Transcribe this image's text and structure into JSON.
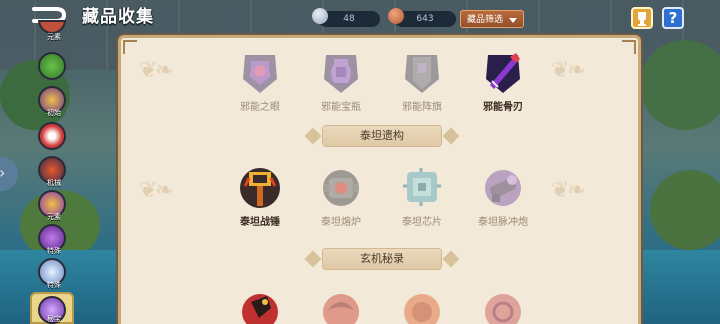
{
  "header": {
    "title": "藏品收集",
    "crystal_count": "48",
    "meat_count": "643",
    "filter_label": "藏品筛选"
  },
  "sidebar": {
    "items": [
      {
        "label": "元素",
        "icon": "creature-red-icon"
      },
      {
        "label": "",
        "icon": "creature-green-icon"
      },
      {
        "label": "初始",
        "icon": "creature-hat-icon"
      },
      {
        "label": "",
        "icon": "creature-mushroom-icon"
      },
      {
        "label": "机械",
        "icon": "creature-mech-icon"
      },
      {
        "label": "元素",
        "icon": "creature-purple-icon"
      },
      {
        "label": "特殊",
        "icon": "creature-spiky-icon"
      },
      {
        "label": "特殊",
        "icon": "creature-ghost-icon"
      },
      {
        "label": "秘宝",
        "icon": "creature-orb-icon"
      }
    ]
  },
  "panel": {
    "row1": [
      {
        "label": "邪能之眼",
        "owned": false,
        "icon": "evil-eye-icon"
      },
      {
        "label": "邪能宝瓶",
        "owned": false,
        "icon": "evil-vase-icon"
      },
      {
        "label": "邪能阵旗",
        "owned": false,
        "icon": "evil-banner-icon"
      },
      {
        "label": "邪能骨刃",
        "owned": true,
        "icon": "evil-bone-blade-icon"
      }
    ],
    "section_titan": "泰坦遗构",
    "row2": [
      {
        "label": "泰坦战锤",
        "owned": true,
        "icon": "titan-hammer-icon"
      },
      {
        "label": "泰坦熔炉",
        "owned": false,
        "icon": "titan-furnace-icon"
      },
      {
        "label": "泰坦芯片",
        "owned": false,
        "icon": "titan-chip-icon"
      },
      {
        "label": "泰坦脉冲炮",
        "owned": false,
        "icon": "titan-cannon-icon"
      }
    ],
    "section_mystic": "玄机秘录",
    "row3": [
      {
        "owned": true,
        "icon": "mystic-red-icon"
      },
      {
        "owned": false,
        "icon": "mystic-dragon-icon"
      },
      {
        "owned": false,
        "icon": "mystic-beast-icon"
      },
      {
        "owned": false,
        "icon": "mystic-orb-icon"
      }
    ]
  },
  "colors": {
    "panel_bg": "#f3e9d8",
    "panel_border": "#c9a878",
    "filter_button": "#b86a3a",
    "help_button": "#2f6fd0",
    "collection_button": "#e3a53a"
  }
}
